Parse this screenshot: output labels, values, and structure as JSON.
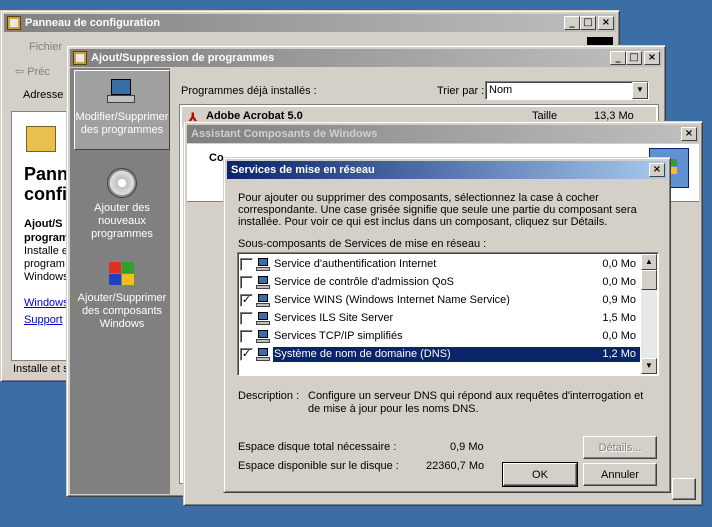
{
  "control_panel": {
    "title": "Panneau de configuration",
    "menu": {
      "file": "Fichier"
    },
    "back_label": "Préc",
    "address_label": "Adresse",
    "heading": "Pann\nconfi",
    "sub_heading": "Ajout/S",
    "sub_lines": [
      "program",
      "Installe e",
      "program",
      "Windows"
    ],
    "links": [
      "Windows",
      "Support"
    ],
    "status": "Installe et s"
  },
  "add_remove": {
    "title": "Ajout/Suppression de programmes",
    "sidebar": [
      {
        "label": "Modifier/Supprimer des programmes",
        "icon": "change-remove-programs-icon"
      },
      {
        "label": "Ajouter des nouveaux programmes",
        "icon": "add-new-programs-icon"
      },
      {
        "label": "Ajouter/Supprimer des composants Windows",
        "icon": "windows-components-icon"
      }
    ],
    "installed_label": "Programmes déjà installés :",
    "sort_label": "Trier par :",
    "sort_value": "Nom",
    "program": {
      "name": "Adobe Acrobat 5.0",
      "size_label": "Taille",
      "size": "13,3 Mo"
    }
  },
  "components_wizard": {
    "title": "Assistant Composants de Windows",
    "partial_heading": "Co"
  },
  "network_services": {
    "title": "Services de mise en réseau",
    "instructions": "Pour ajouter ou supprimer des composants, sélectionnez la case à cocher correspondante. Une case grisée signifie que seule une partie du composant sera installée. Pour voir ce qui est inclus dans un composant, cliquez sur Détails.",
    "subcomponents_label": "Sous-composants de Services de mise en réseau :",
    "items": [
      {
        "name": "Service d'authentification Internet",
        "size": "0,0 Mo",
        "checked": false
      },
      {
        "name": "Service de contrôle d'admission QoS",
        "size": "0,0 Mo",
        "checked": false
      },
      {
        "name": "Service WINS (Windows Internet Name Service)",
        "size": "0,9 Mo",
        "checked": true
      },
      {
        "name": "Services ILS Site Server",
        "size": "1,5 Mo",
        "checked": false
      },
      {
        "name": "Services TCP/IP simplifiés",
        "size": "0,0 Mo",
        "checked": false
      },
      {
        "name": "Système de nom de domaine (DNS)",
        "size": "1,2 Mo",
        "checked": true,
        "selected": true
      }
    ],
    "description_label": "Description :",
    "description": "Configure un serveur DNS qui répond aux requêtes d'interrogation et de mise à jour pour les noms DNS.",
    "disk_required_label": "Espace disque total nécessaire :",
    "disk_required": "0,9 Mo",
    "disk_available_label": "Espace disponible sur le disque :",
    "disk_available": "22360,7 Mo",
    "details_button": "Détails...",
    "ok_button": "OK",
    "cancel_button": "Annuler"
  },
  "colors": {
    "titlebar_active": "#0a246a",
    "desktop": "#3a6ea5",
    "selection": "#0a246a"
  }
}
